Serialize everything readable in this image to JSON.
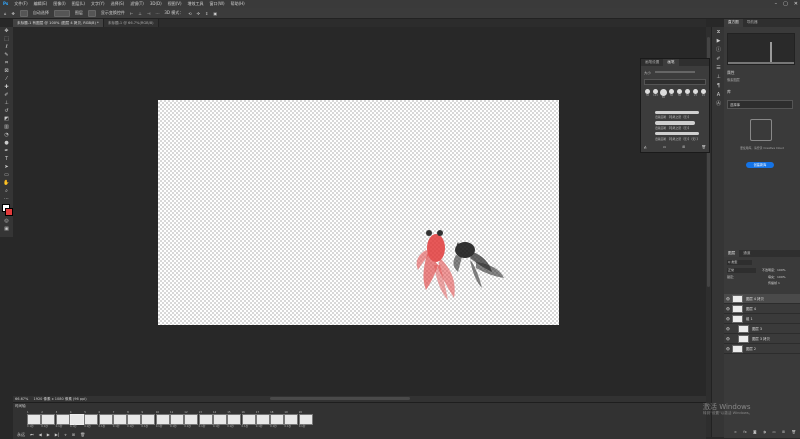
{
  "menu": [
    "文件(F)",
    "编辑(E)",
    "图像(I)",
    "图层(L)",
    "文字(Y)",
    "选择(S)",
    "滤镜(T)",
    "3D(D)",
    "视图(V)",
    "增效工具",
    "窗口(W)",
    "帮助(H)"
  ],
  "options": {
    "mode_label": "对齐边缘",
    "auto_label": "自动选择",
    "auto_select": "图层",
    "transform_label": "显示变换控件",
    "mode_3d": "3D 模式："
  },
  "tabs": [
    {
      "label": "未标题-1 有图层 @ 100% (图层 4 拷贝, RGB/8) *"
    },
    {
      "label": "未标题-1 @ 66.7%(RGB/8)"
    }
  ],
  "status": {
    "zoom": "66.67%",
    "doc_info": "1920 像素 x 1080 像素 (96 ppi)"
  },
  "timeline": {
    "title": "时间轴",
    "frames": [
      {
        "n": "1",
        "d": "0.1秒"
      },
      {
        "n": "2",
        "d": "0.1秒"
      },
      {
        "n": "3",
        "d": "0.1秒"
      },
      {
        "n": "4",
        "d": "0.1秒"
      },
      {
        "n": "5",
        "d": "0.1秒"
      },
      {
        "n": "6",
        "d": "0.1秒"
      },
      {
        "n": "7",
        "d": "0.1秒"
      },
      {
        "n": "8",
        "d": "0.1秒"
      },
      {
        "n": "9",
        "d": "0.1秒"
      },
      {
        "n": "10",
        "d": "0.1秒"
      },
      {
        "n": "11",
        "d": "0.1秒"
      },
      {
        "n": "12",
        "d": "0.1秒"
      },
      {
        "n": "13",
        "d": "0.1秒"
      },
      {
        "n": "14",
        "d": "0.1秒"
      },
      {
        "n": "15",
        "d": "0.1秒"
      },
      {
        "n": "16",
        "d": "0.1秒"
      },
      {
        "n": "17",
        "d": "0.1秒"
      },
      {
        "n": "18",
        "d": "0.1秒"
      },
      {
        "n": "19",
        "d": "0.1秒"
      },
      {
        "n": "20",
        "d": "0.1秒"
      }
    ],
    "loop": "永远"
  },
  "brush_panel": {
    "tabs": [
      "画笔设置",
      "画笔"
    ],
    "size_label": "大小",
    "tips": [
      "30",
      "123",
      "60",
      "30",
      "30",
      "30",
      "25",
      "45"
    ],
    "strokes": [
      {
        "label": "旧版画笔 【毛笔之怒（无）】"
      },
      {
        "label": "旧版画笔 【毛笔之怒（无）】"
      },
      {
        "label": "旧版画笔 【毛笔之怒（无）】（无）】"
      }
    ]
  },
  "right_panel": {
    "tab1": "直方图",
    "tab2": "导航器",
    "props_title": "属性",
    "props_sub": "像素图层",
    "lib_title": "库",
    "lib_sub": "选择库",
    "lib_desc": "要使用库，请登录 Creative Cloud",
    "lib_button": "创建新库",
    "layers_tab": "图层",
    "channels_tab": "通道",
    "filter_kind": "Q 类型",
    "blend_mode": "正常",
    "opacity_label": "不透明度：100%",
    "lock_label": "锁定：",
    "fill_label": "填充：100%",
    "propagate": "传播帧 1"
  },
  "layers": [
    {
      "name": "图层 4 拷贝",
      "selected": true,
      "indent": 0
    },
    {
      "name": "图层 4",
      "selected": false,
      "indent": 0
    },
    {
      "name": "组 1",
      "selected": false,
      "indent": 0
    },
    {
      "name": "图层 3",
      "selected": false,
      "indent": 1
    },
    {
      "name": "图层 3 拷贝",
      "selected": false,
      "indent": 1
    },
    {
      "name": "图层 2",
      "selected": false,
      "indent": 0
    }
  ],
  "watermark": {
    "line1": "激活 Windows",
    "line2": "转到\"设置\"以激活 Windows。"
  },
  "colors": {
    "accent": "#1473e6",
    "canvas_bg": "#282828",
    "fish_red": "#e23b3b",
    "fish_black": "#111111"
  },
  "icons": {
    "home": "home-icon",
    "move": "move-tool-icon",
    "search": "search-icon"
  }
}
